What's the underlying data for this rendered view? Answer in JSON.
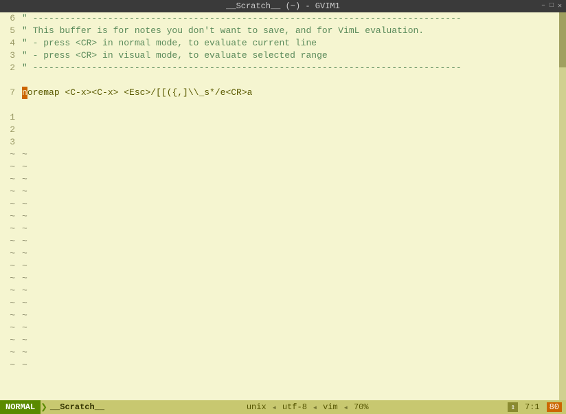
{
  "titleBar": {
    "title": "__Scratch__ (~) - GVIM1",
    "controls": [
      "–",
      "□",
      "✕"
    ]
  },
  "editor": {
    "lines": [
      {
        "num": "6",
        "type": "dashes",
        "content": "\" --------------------------------------------------------------------------------"
      },
      {
        "num": "5",
        "type": "comment",
        "content": "\" This buffer is for notes you don't want to save, and for VimL evaluation."
      },
      {
        "num": "4",
        "type": "comment",
        "content": "\" - press <CR> in normal mode, to evaluate current line"
      },
      {
        "num": "3",
        "type": "comment",
        "content": "\" - press <CR> in visual mode, to evaluate selected range"
      },
      {
        "num": "2",
        "type": "dashes",
        "content": "\" --------------------------------------------------------------------------------"
      },
      {
        "num": "",
        "type": "blank",
        "content": ""
      },
      {
        "num": "7",
        "type": "code",
        "content": "noremap <C-x><C-x> <Esc>/[[({,]\\_s*/e<CR>a",
        "cursor_pos": 0
      },
      {
        "num": "",
        "type": "blank",
        "content": ""
      },
      {
        "num": "1",
        "type": "blank",
        "content": ""
      },
      {
        "num": "2",
        "type": "blank",
        "content": ""
      },
      {
        "num": "3",
        "type": "blank",
        "content": ""
      }
    ],
    "tildes": 18
  },
  "statusBar": {
    "mode": "NORMAL",
    "filename": "__Scratch__",
    "fileFormat": "unix",
    "encoding": "utf-8",
    "filetype": "vim",
    "percent": "70%",
    "lineCol": "7:1",
    "colWidth": "80",
    "arrow": "❯"
  }
}
